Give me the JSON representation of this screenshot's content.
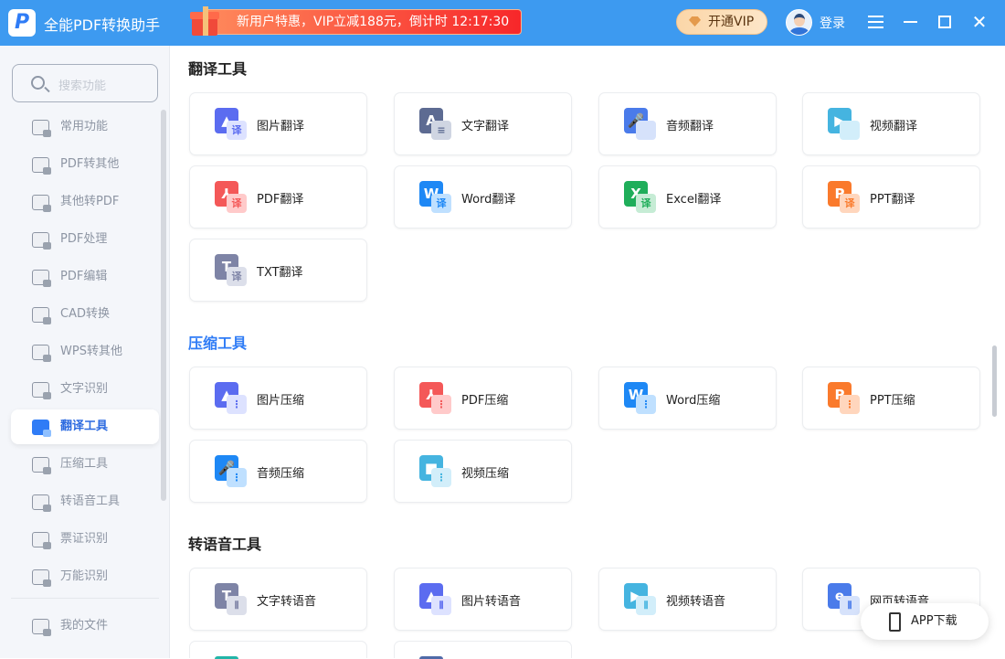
{
  "titlebar": {
    "logo": "P",
    "title": "全能PDF转换助手",
    "promo": "新用户特惠，VIP立减188元，倒计时 12:17:30",
    "vip": "开通VIP",
    "login": "登录"
  },
  "sidebar": {
    "search_placeholder": "搜索功能",
    "items": [
      {
        "label": "常用功能"
      },
      {
        "label": "PDF转其他"
      },
      {
        "label": "其他转PDF"
      },
      {
        "label": "PDF处理"
      },
      {
        "label": "PDF编辑"
      },
      {
        "label": "CAD转换"
      },
      {
        "label": "WPS转其他"
      },
      {
        "label": "文字识别"
      },
      {
        "label": "翻译工具",
        "active": true
      },
      {
        "label": "压缩工具"
      },
      {
        "label": "转语音工具"
      },
      {
        "label": "票证识别"
      },
      {
        "label": "万能识别"
      }
    ],
    "my_files": "我的文件"
  },
  "sections": [
    {
      "title": "翻译工具",
      "cards": [
        {
          "label": "图片翻译",
          "color": "#5b6cf0",
          "glyph": "▲",
          "badge": "译",
          "bcolor": "#dde2ff",
          "btext": "#5b6cf0"
        },
        {
          "label": "文字翻译",
          "color": "#5d6b92",
          "glyph": "A",
          "badge": "≡",
          "bcolor": "#cfd5e2",
          "btext": "#5d6b92"
        },
        {
          "label": "音频翻译",
          "color": "#4a7bea",
          "glyph": "🎤",
          "badge": "",
          "bcolor": "#d6e2fb",
          "btext": "#4a7bea"
        },
        {
          "label": "视频翻译",
          "color": "#45b4e0",
          "glyph": "▶",
          "badge": "",
          "bcolor": "#d2eefa",
          "btext": "#45b4e0"
        },
        {
          "label": "PDF翻译",
          "color": "#f45858",
          "glyph": "⅄",
          "badge": "译",
          "bcolor": "#ffcaca",
          "btext": "#f45858"
        },
        {
          "label": "Word翻译",
          "color": "#1e88f5",
          "glyph": "W",
          "badge": "译",
          "bcolor": "#bfe0ff",
          "btext": "#1e88f5"
        },
        {
          "label": "Excel翻译",
          "color": "#1fae5a",
          "glyph": "X",
          "badge": "译",
          "bcolor": "#c6ecd5",
          "btext": "#1fae5a"
        },
        {
          "label": "PPT翻译",
          "color": "#fa7a2c",
          "glyph": "P",
          "badge": "译",
          "bcolor": "#ffd6bd",
          "btext": "#fa7a2c"
        },
        {
          "label": "TXT翻译",
          "color": "#7e84a6",
          "glyph": "T",
          "badge": "译",
          "bcolor": "#dcdfea",
          "btext": "#7e84a6"
        }
      ]
    },
    {
      "title": "压缩工具",
      "cards": [
        {
          "label": "图片压缩",
          "color": "#5b6cf0",
          "glyph": "▲",
          "badge": "⋮",
          "bcolor": "#dde2ff",
          "btext": "#5b6cf0"
        },
        {
          "label": "PDF压缩",
          "color": "#f45858",
          "glyph": "⅄",
          "badge": "⋮",
          "bcolor": "#ffcaca",
          "btext": "#f45858"
        },
        {
          "label": "Word压缩",
          "color": "#1e88f5",
          "glyph": "W",
          "badge": "⋮",
          "bcolor": "#bfe0ff",
          "btext": "#1e88f5"
        },
        {
          "label": "PPT压缩",
          "color": "#fa7a2c",
          "glyph": "P",
          "badge": "⋮",
          "bcolor": "#ffd6bd",
          "btext": "#fa7a2c"
        },
        {
          "label": "音频压缩",
          "color": "#1e88f5",
          "glyph": "🎤",
          "badge": "⋮",
          "bcolor": "#bfe0ff",
          "btext": "#1e88f5"
        },
        {
          "label": "视频压缩",
          "color": "#45b4e0",
          "glyph": "■",
          "badge": "⋮",
          "bcolor": "#d2eefa",
          "btext": "#45b4e0"
        }
      ]
    },
    {
      "title": "转语音工具",
      "cards": [
        {
          "label": "文字转语音",
          "color": "#7e84a6",
          "glyph": "T",
          "badge": "⦀",
          "bcolor": "#dcdfea",
          "btext": "#7e84a6"
        },
        {
          "label": "图片转语音",
          "color": "#5b6cf0",
          "glyph": "▲",
          "badge": "⦀",
          "bcolor": "#dde2ff",
          "btext": "#5b6cf0"
        },
        {
          "label": "视频转语音",
          "color": "#45b4e0",
          "glyph": "▶",
          "badge": "⦀",
          "bcolor": "#d2eefa",
          "btext": "#45b4e0"
        },
        {
          "label": "网页转语音",
          "color": "#4a7bea",
          "glyph": "e",
          "badge": "⦀",
          "bcolor": "#d6e2fb",
          "btext": "#4a7bea"
        },
        {
          "label": "",
          "color": "#22b5a8",
          "glyph": "",
          "badge": "",
          "bcolor": "#fff",
          "btext": "#fff"
        },
        {
          "label": "",
          "color": "#4f6aa8",
          "glyph": "",
          "badge": "",
          "bcolor": "#fff",
          "btext": "#fff"
        }
      ]
    }
  ],
  "app_download": "APP下载"
}
